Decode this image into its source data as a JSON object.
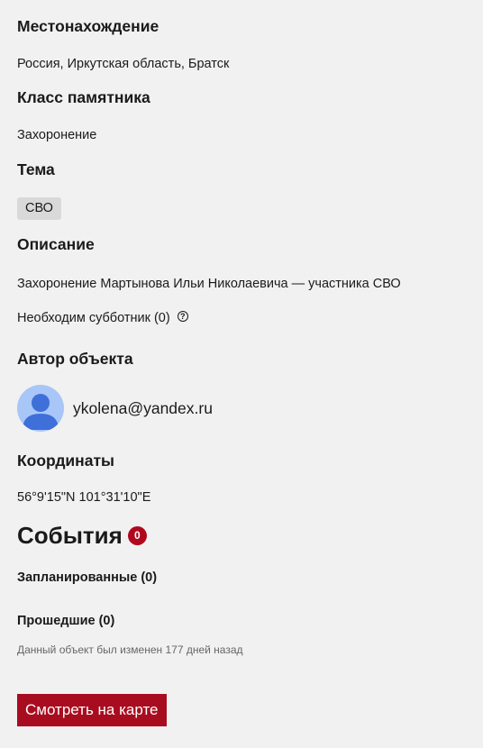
{
  "location": {
    "heading": "Местонахождение",
    "value": "Россия, Иркутская область, Братск"
  },
  "monument_class": {
    "heading": "Класс памятника",
    "value": "Захоронение"
  },
  "topic": {
    "heading": "Тема",
    "tag": "СВО"
  },
  "description": {
    "heading": "Описание",
    "text": "Захоронение Мартынова Ильи Николаевича — участника СВО",
    "subbotnik": "Необходим субботник (0)",
    "help_icon": "?"
  },
  "author": {
    "heading": "Автор объекта",
    "email": "ykolena@yandex.ru"
  },
  "coordinates": {
    "heading": "Координаты",
    "value": "56°9'15\"N 101°31'10\"E"
  },
  "events": {
    "heading": "События",
    "count": "0",
    "planned": "Запланированные (0)",
    "past": "Прошедшие (0)"
  },
  "modified_note": "Данный объект был изменен 177 дней назад",
  "map_button": "Смотреть на карте",
  "colors": {
    "background": "#f1f1f1",
    "accent": "#a80d1f",
    "avatar": "#a8c6f7",
    "avatar_figure": "#3f6fd8"
  }
}
